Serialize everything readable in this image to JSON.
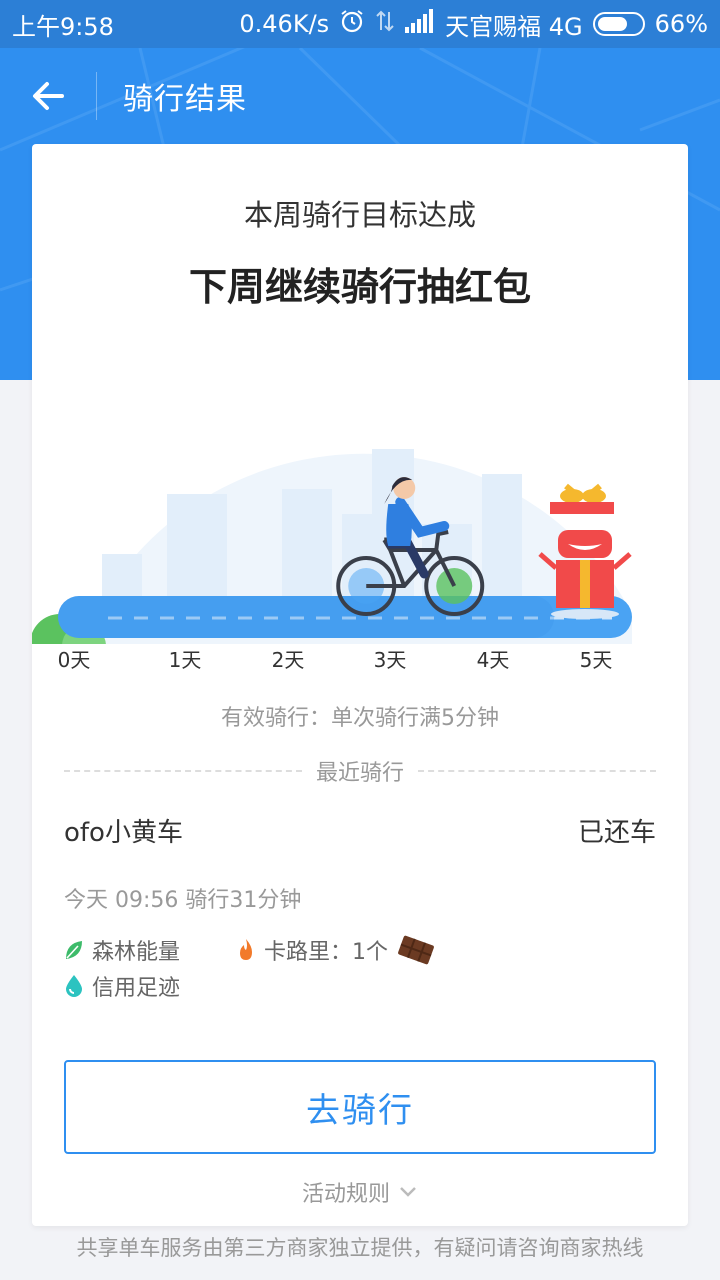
{
  "status_bar": {
    "time": "上午9:58",
    "speed": "0.46K/s",
    "carrier": "天官赐福 4G",
    "battery": "66%",
    "battery_level": 0.66
  },
  "header": {
    "title": "骑行结果",
    "back_icon": "arrow-left-icon"
  },
  "card": {
    "subtitle": "本周骑行目标达成",
    "title": "下周继续骑行抽红包",
    "progress_days": [
      "0天",
      "1天",
      "2天",
      "3天",
      "4天",
      "5天"
    ],
    "progress_value": 4.6,
    "valid_ride_note": "有效骑行：单次骑行满5分钟",
    "recent_label": "最近骑行",
    "ride": {
      "name": "ofo小黄车",
      "status": "已还车",
      "time": "今天 09:56 骑行31分钟",
      "tags": {
        "forest": "森林能量",
        "calorie": "卡路里：1个",
        "credit": "信用足迹"
      }
    },
    "go_button": "去骑行",
    "rules_label": "活动规则"
  },
  "footer": {
    "note": "共享单车服务由第三方商家独立提供，有疑问请咨询商家热线"
  },
  "colors": {
    "primary": "#2f8ff0",
    "status_bar": "#2c7fd6",
    "road": "#4aa3f3",
    "gift_red": "#f14a4a"
  }
}
